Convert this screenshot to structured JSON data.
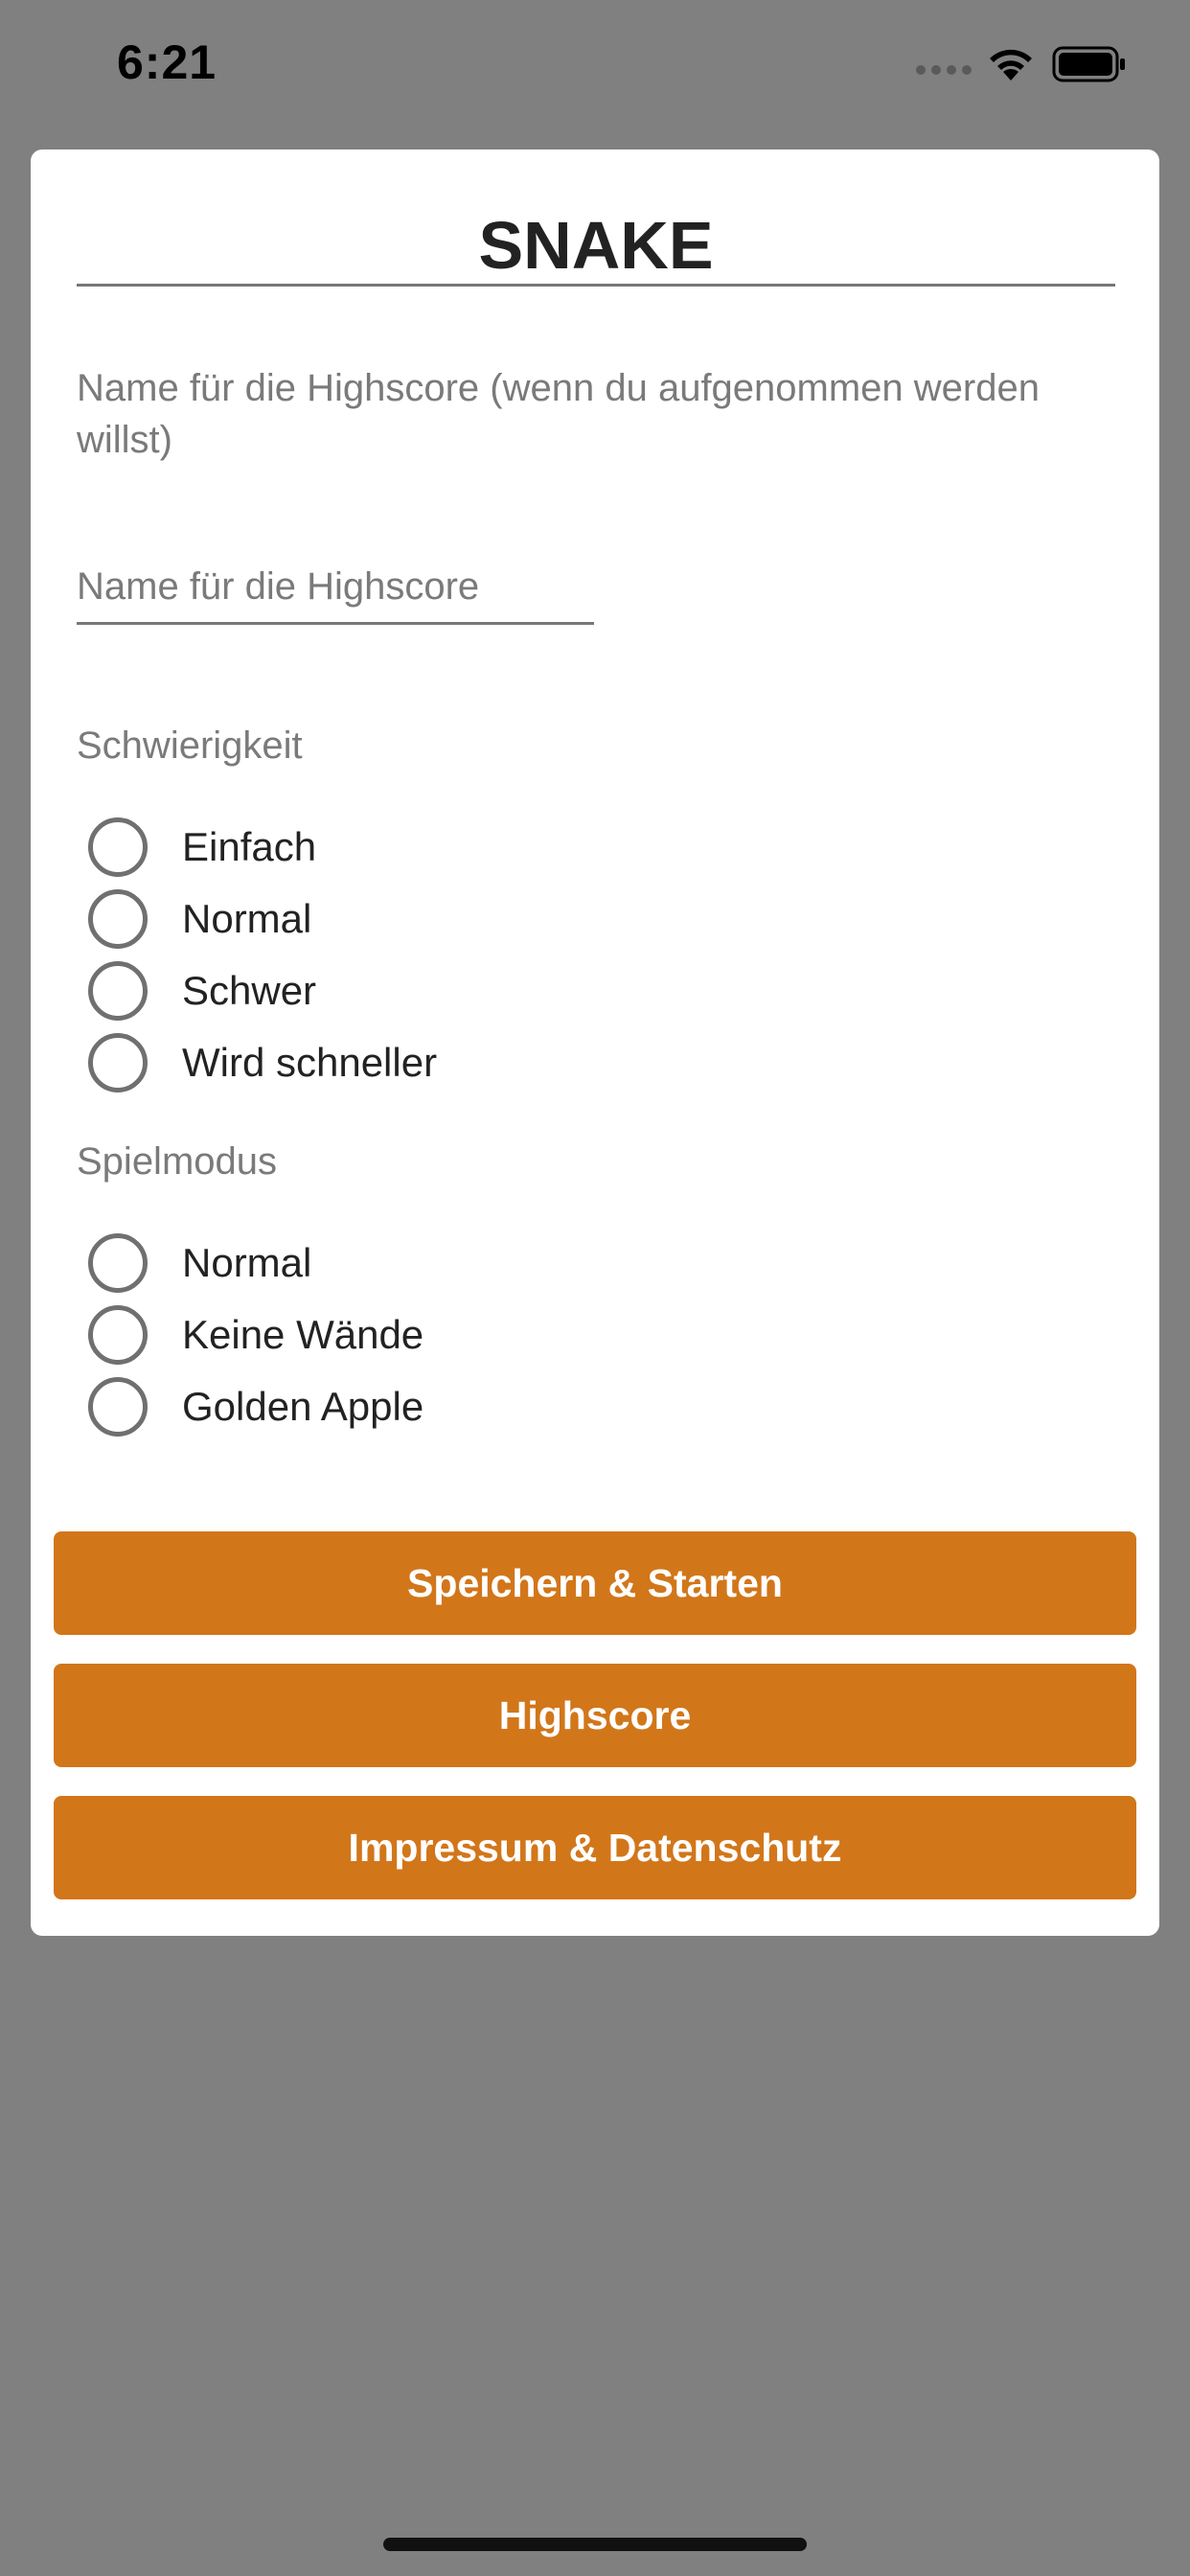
{
  "status_bar": {
    "time": "6:21"
  },
  "app": {
    "title": "SNAKE",
    "intro": "Name für die Highscore (wenn du aufgenommen werden willst)",
    "name_input": {
      "placeholder": "Name für die Highscore",
      "value": ""
    },
    "difficulty": {
      "label": "Schwierigkeit",
      "options": [
        "Einfach",
        "Normal",
        "Schwer",
        "Wird schneller"
      ]
    },
    "game_mode": {
      "label": "Spielmodus",
      "options": [
        "Normal",
        "Keine Wände",
        "Golden Apple"
      ]
    },
    "buttons": {
      "save_start": "Speichern & Starten",
      "highscore": "Highscore",
      "imprint": "Impressum & Datenschutz"
    }
  },
  "colors": {
    "background": "#808080",
    "button": "#d2761a",
    "card": "#ffffff"
  }
}
